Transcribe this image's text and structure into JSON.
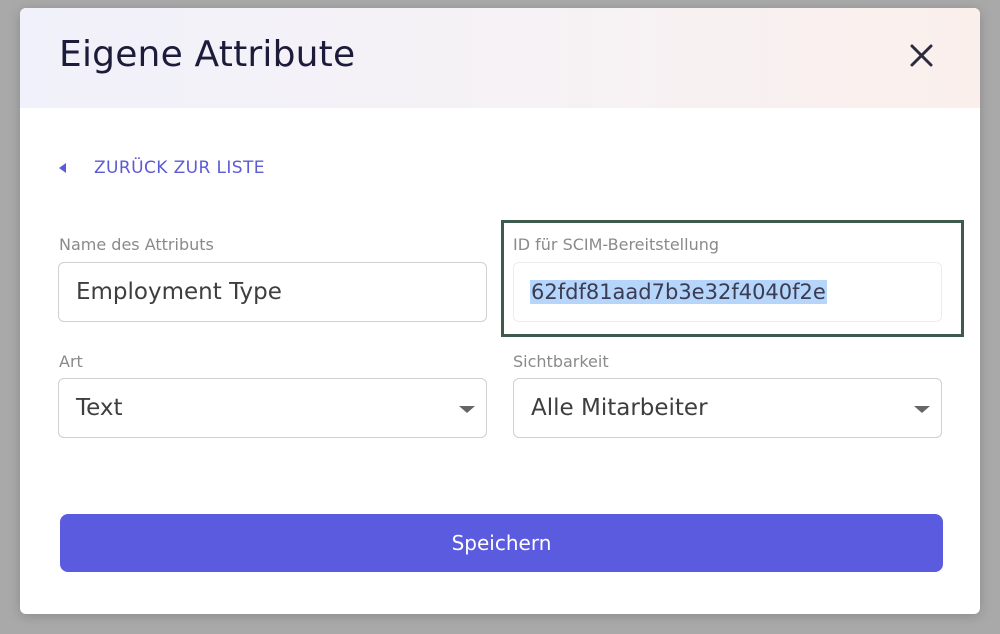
{
  "modal": {
    "title": "Eigene Attribute"
  },
  "nav": {
    "back_label": "ZURÜCK ZUR LISTE"
  },
  "form": {
    "name_label": "Name des Attributs",
    "name_value": "Employment Type",
    "scim_label": "ID für SCIM-Bereitstellung",
    "scim_value": "62fdf81aad7b3e32f4040f2e",
    "type_label": "Art",
    "type_value": "Text",
    "visibility_label": "Sichtbarkeit",
    "visibility_value": "Alle Mitarbeiter"
  },
  "actions": {
    "save_label": "Speichern"
  },
  "colors": {
    "accent": "#5b5be0",
    "link": "#5c5bd6",
    "selection": "#b5d5fb",
    "focus_outline": "#3d5a4c",
    "title_text": "#1c1c3a"
  },
  "icons": {
    "close": "close-icon",
    "back": "caret-left-icon",
    "dropdown": "caret-down-icon"
  }
}
